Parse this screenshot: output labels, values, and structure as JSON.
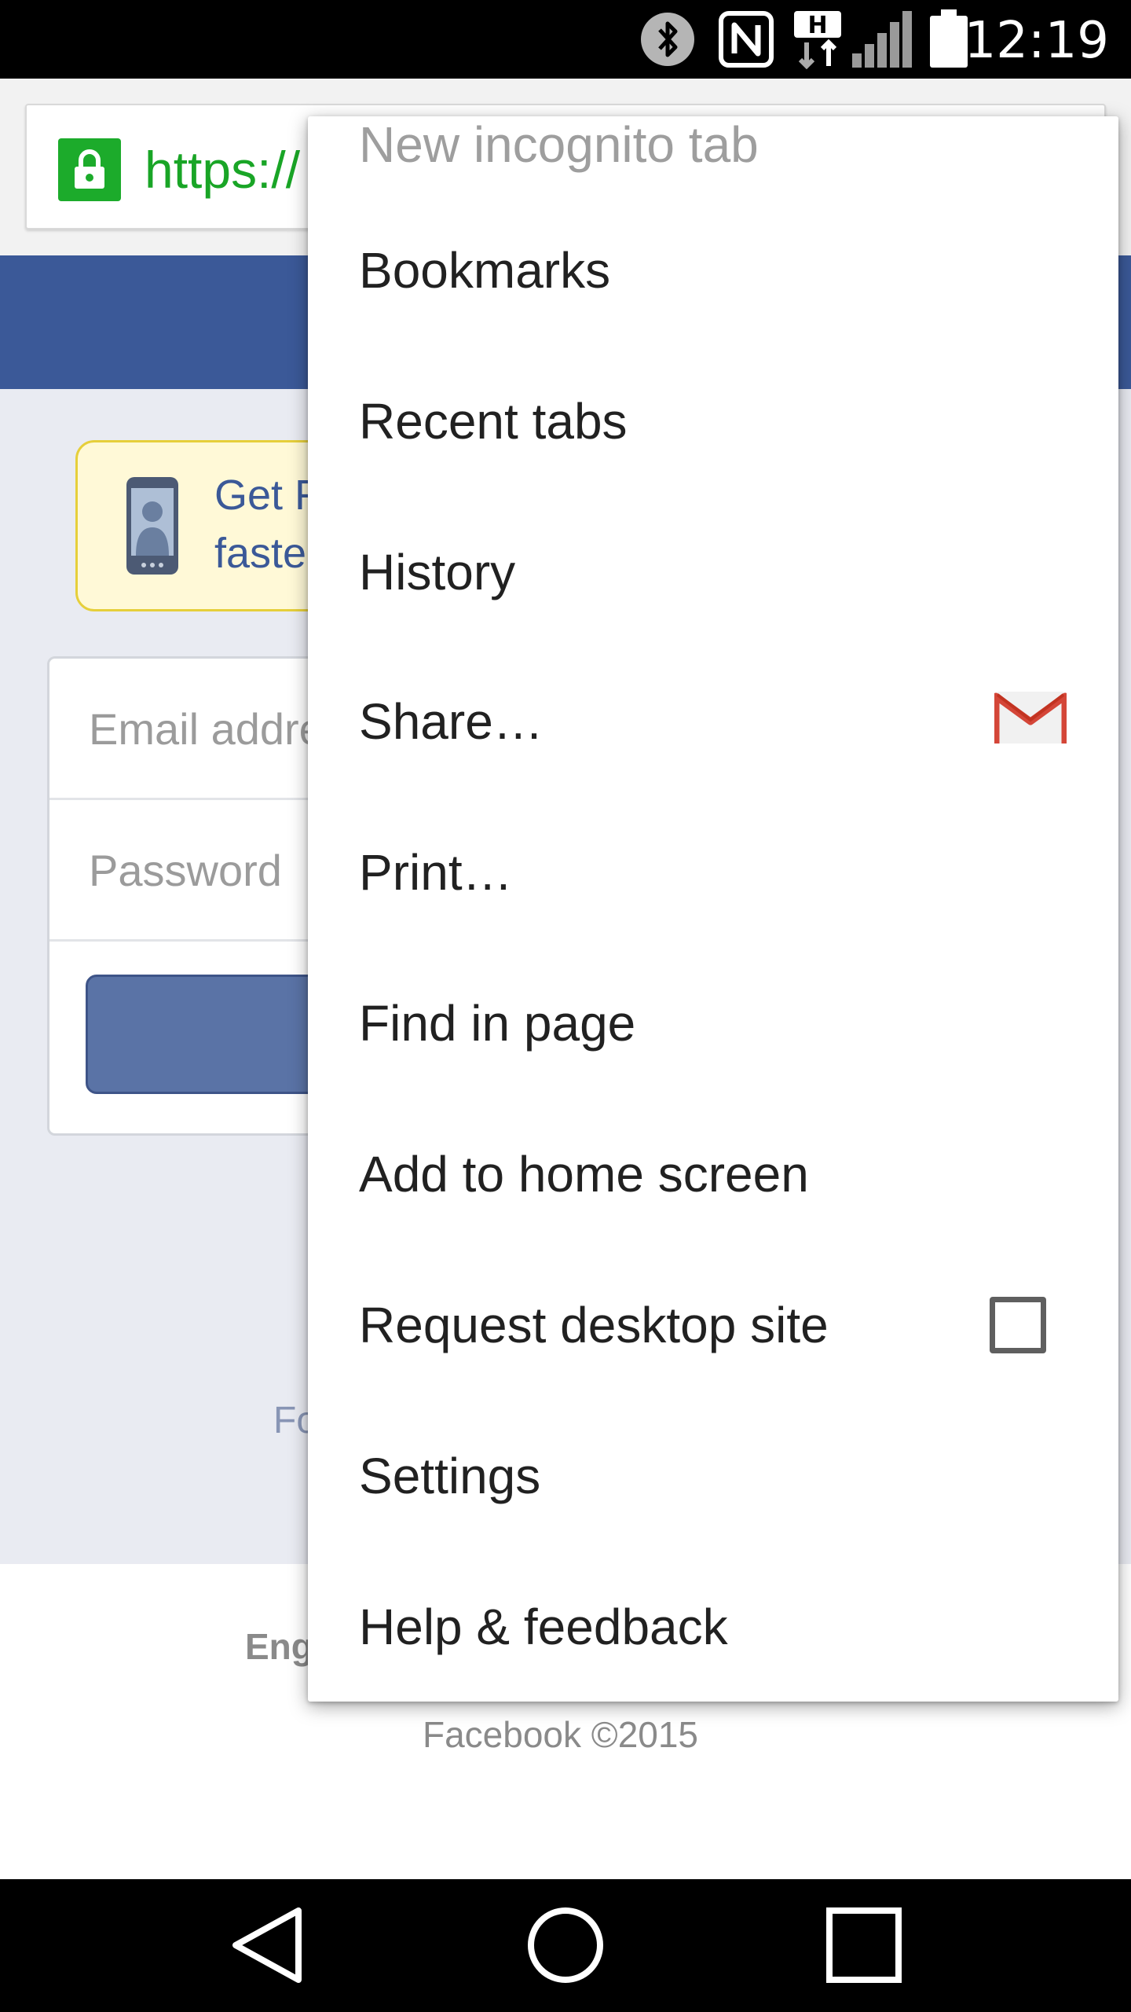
{
  "status_bar": {
    "time": "12:19",
    "icons": [
      "bluetooth-icon",
      "nfc-icon",
      "hspa-data-icon",
      "signal-icon",
      "battery-icon"
    ],
    "network_label": "H"
  },
  "browser": {
    "url": "https://",
    "lock_color": "#1cab2b"
  },
  "page": {
    "header_color": "#3b5998",
    "app_banner_text": "Get F\nfaste",
    "email_placeholder": "Email addre",
    "password_placeholder": "Password",
    "forgot_link": "Fo",
    "footer_language": "Eng",
    "footer_copyright": "Facebook ©2015"
  },
  "menu": {
    "items": [
      {
        "label": "New incognito tab"
      },
      {
        "label": "Bookmarks"
      },
      {
        "label": "Recent tabs"
      },
      {
        "label": "History"
      },
      {
        "label": "Share…",
        "icon": "gmail-icon"
      },
      {
        "label": "Print…"
      },
      {
        "label": "Find in page"
      },
      {
        "label": "Add to home screen"
      },
      {
        "label": "Request desktop site",
        "checked": false
      },
      {
        "label": "Settings"
      },
      {
        "label": "Help & feedback"
      }
    ]
  },
  "nav_bar": {
    "buttons": [
      "back-icon",
      "home-icon",
      "recents-icon"
    ]
  }
}
